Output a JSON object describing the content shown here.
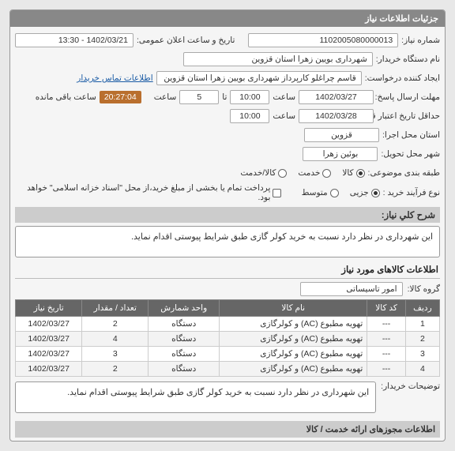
{
  "header": {
    "title": "جزئیات اطلاعات نیاز"
  },
  "labels": {
    "need_no": "شماره نیاز:",
    "announce": "تاریخ و ساعت اعلان عمومی:",
    "buyer_org": "نام دستگاه خریدار:",
    "requester": "ایجاد کننده درخواست:",
    "deadline": "مهلت ارسال پاسخ:",
    "saat": "ساعت",
    "ta": "تا",
    "credit": "حداقل تاریخ اعتبار قیمت: تا تاریخ:",
    "execute_prov": "استان محل اجرا:",
    "deliver_city": "شهر محل تحویل:",
    "category": "طبقه بندی موضوعی:",
    "process": "نوع فرآیند خرید :",
    "remaining": "ساعت باقی مانده",
    "contact_link": "اطلاعات تماس خریدار",
    "pay_note": "پرداخت تمام یا بخشی از مبلغ خرید،از محل \"اسناد خزانه اسلامی\" خواهد بود.",
    "desc_title": "شرح کلي نیاز:",
    "items_title": "اطلاعات کالاهای مورد نیاز",
    "group": "گروه کالا:",
    "buyer_notes": "توضیحات خریدار:",
    "footer": "اطلاعات مجوزهای ارائه خدمت / کالا"
  },
  "values": {
    "need_no": "1102005080000013",
    "announce": "1402/03/21 - 13:30",
    "buyer_org": "شهرداری بویین زهرا استان قزوین",
    "requester": "قاسم چراغلو کارپرداز شهرداری بویین زهرا استان قزوین",
    "deadline_date": "1402/03/27",
    "deadline_time": "10:00",
    "ta_val": "5",
    "remaining": "20:27:04",
    "credit_date": "1402/03/28",
    "credit_time": "10:00",
    "province": "قزوین",
    "city": "بوئین زهرا",
    "desc": "این شهرداری در نظر دارد نسبت به خرید کولر گازی طبق شرایط پیوستی اقدام نماید.",
    "group": "امور تاسیساتی",
    "buyer_notes": "این شهرداری در نظر دارد نسبت به خرید کولر گازی طبق شرایط پیوستی اقدام نماید."
  },
  "category_opts": {
    "kala": "کالا",
    "khadamat": "خدمت",
    "kala_khadamat": "کالا/خدمت"
  },
  "process_opts": {
    "joze": "جزیی",
    "motavaset": "متوسط"
  },
  "table": {
    "headers": {
      "row": "ردیف",
      "code": "کد کالا",
      "name": "نام کالا",
      "unit": "واحد شمارش",
      "qty": "تعداد / مقدار",
      "date": "تاریخ نیاز"
    },
    "rows": [
      {
        "n": "1",
        "code": "---",
        "name": "تهویه مطبوع (AC) و کولرگازی",
        "unit": "دستگاه",
        "qty": "2",
        "date": "1402/03/27"
      },
      {
        "n": "2",
        "code": "---",
        "name": "تهویه مطبوع (AC) و کولرگازی",
        "unit": "دستگاه",
        "qty": "4",
        "date": "1402/03/27"
      },
      {
        "n": "3",
        "code": "---",
        "name": "تهویه مطبوع (AC) و کولرگازی",
        "unit": "دستگاه",
        "qty": "3",
        "date": "1402/03/27"
      },
      {
        "n": "4",
        "code": "---",
        "name": "تهویه مطبوع (AC) و کولرگازی",
        "unit": "دستگاه",
        "qty": "2",
        "date": "1402/03/27"
      }
    ]
  }
}
